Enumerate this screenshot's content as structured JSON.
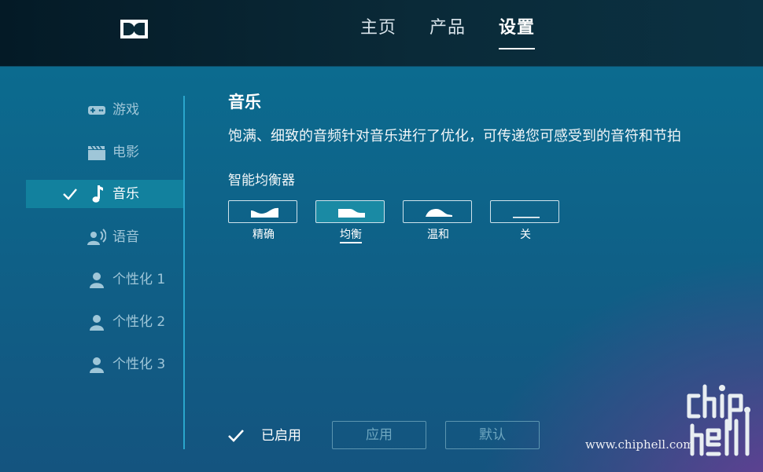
{
  "header": {
    "logo": "dolby-logo",
    "nav": [
      {
        "label": "主页",
        "active": false
      },
      {
        "label": "产品",
        "active": false
      },
      {
        "label": "设置",
        "active": true
      }
    ]
  },
  "sidebar": {
    "items": [
      {
        "label": "游戏",
        "icon": "gamepad-icon"
      },
      {
        "label": "电影",
        "icon": "clapperboard-icon"
      },
      {
        "label": "音乐",
        "icon": "music-note-icon",
        "active": true
      },
      {
        "label": "语音",
        "icon": "voice-icon"
      },
      {
        "label": "个性化 1",
        "icon": "user-icon"
      },
      {
        "label": "个性化 2",
        "icon": "user-icon"
      },
      {
        "label": "个性化 3",
        "icon": "user-icon"
      }
    ]
  },
  "main": {
    "title": "音乐",
    "description": "饱满、细致的音频针对音乐进行了优化，可传递您可感受到的音符和节拍",
    "equalizer": {
      "title": "智能均衡器",
      "options": [
        {
          "label": "精确",
          "active": false
        },
        {
          "label": "均衡",
          "active": true
        },
        {
          "label": "温和",
          "active": false
        },
        {
          "label": "关",
          "active": false
        }
      ]
    }
  },
  "footer": {
    "enabled_label": "已启用",
    "apply_label": "应用",
    "default_label": "默认"
  },
  "watermark": {
    "url": "www.chiphell.com",
    "logo": "chiphell-logo"
  },
  "colors": {
    "accent": "#12819e",
    "header_bg": "#041a26",
    "sidebar_line": "#2aa6cc"
  }
}
